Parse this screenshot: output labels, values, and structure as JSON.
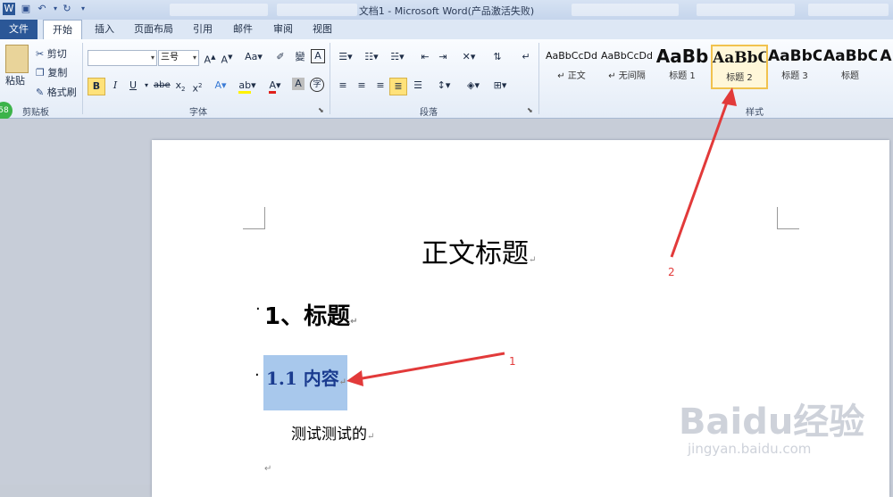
{
  "window": {
    "title": "文档1 - Microsoft Word(产品激活失败)"
  },
  "tabs": [
    "文件",
    "开始",
    "插入",
    "页面布局",
    "引用",
    "邮件",
    "审阅",
    "视图"
  ],
  "clipboard": {
    "paste": "粘贴",
    "cut": "剪切",
    "copy": "复制",
    "format_painter": "格式刷",
    "group": "剪贴板"
  },
  "font": {
    "name": "",
    "size": "三号",
    "group": "字体"
  },
  "paragraph": {
    "group": "段落"
  },
  "styles": {
    "group": "样式",
    "tiles": [
      {
        "preview": "AaBbCcDd",
        "name": "↵ 正文"
      },
      {
        "preview": "AaBbCcDd",
        "name": "↵ 无间隔"
      },
      {
        "preview": "AaBb",
        "name": "标题 1"
      },
      {
        "preview": "AaBbC",
        "name": "标题 2"
      },
      {
        "preview": "AaBbC",
        "name": "标题 3"
      },
      {
        "preview": "AaBbC",
        "name": "标题"
      },
      {
        "preview": "A",
        "name": ""
      }
    ]
  },
  "document": {
    "title": "正文标题",
    "heading1": "1、标题",
    "heading2": "1.1 内容",
    "body": "测试测试的"
  },
  "annotations": {
    "label1": "1",
    "label2": "2"
  },
  "watermark": {
    "main": "Baidu经验",
    "sub": "jingyan.baidu.com"
  },
  "badge": "58"
}
